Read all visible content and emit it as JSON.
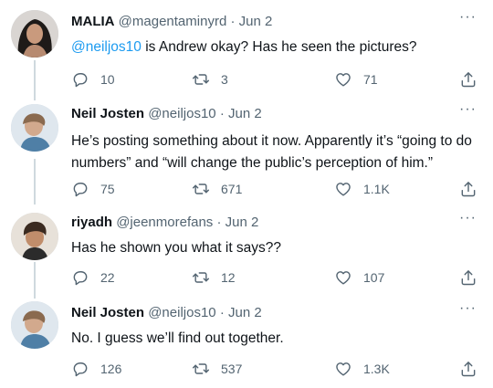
{
  "tweets": [
    {
      "name": "MALIA",
      "handle": "@magentaminyrd",
      "dot": "·",
      "date": "Jun 2",
      "mention": "@neiljos10",
      "text": " is Andrew okay? Has he seen the pictures?",
      "replies": "10",
      "retweets": "3",
      "likes": "71"
    },
    {
      "name": "Neil Josten",
      "handle": "@neiljos10",
      "dot": "·",
      "date": "Jun 2",
      "mention": "",
      "text": "He’s posting something about it now. Apparently it’s “going to do numbers” and “will change the public’s perception of him.”",
      "replies": "75",
      "retweets": "671",
      "likes": "1.1K"
    },
    {
      "name": "riyadh",
      "handle": "@jeenmorefans",
      "dot": "·",
      "date": "Jun 2",
      "mention": "",
      "text": "Has he shown you what it says??",
      "replies": "22",
      "retweets": "12",
      "likes": "107"
    },
    {
      "name": "Neil Josten",
      "handle": "@neiljos10",
      "dot": "·",
      "date": "Jun 2",
      "mention": "",
      "text": "No. I guess we’ll find out together.",
      "replies": "126",
      "retweets": "537",
      "likes": "1.3K"
    }
  ],
  "more_glyph": "···",
  "icons": {
    "reply": "reply-icon",
    "retweet": "retweet-icon",
    "like": "heart-icon",
    "share": "share-icon"
  },
  "colors": {
    "accent": "#1d9bf0",
    "text": "#0f1419",
    "secondary": "#536471",
    "thread_line": "#cfd9de"
  }
}
